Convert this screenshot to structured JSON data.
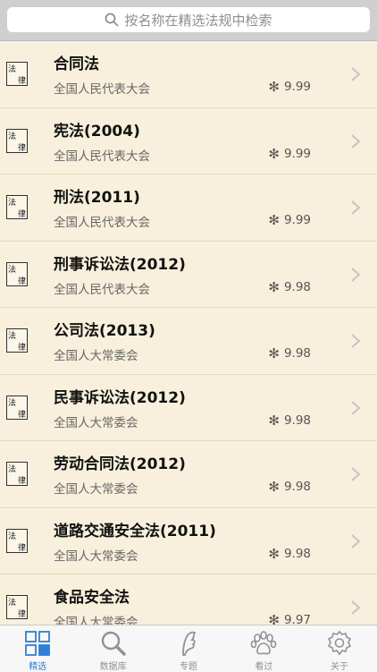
{
  "search": {
    "placeholder": "按名称在精选法规中检索"
  },
  "law_icon": {
    "char1": "法",
    "char2": "律"
  },
  "items": [
    {
      "title": "合同法",
      "issuer": "全国人民代表大会",
      "score": "9.99"
    },
    {
      "title": "宪法(2004)",
      "issuer": "全国人民代表大会",
      "score": "9.99"
    },
    {
      "title": "刑法(2011)",
      "issuer": "全国人民代表大会",
      "score": "9.99"
    },
    {
      "title": "刑事诉讼法(2012)",
      "issuer": "全国人民代表大会",
      "score": "9.98"
    },
    {
      "title": "公司法(2013)",
      "issuer": "全国人大常委会",
      "score": "9.98"
    },
    {
      "title": "民事诉讼法(2012)",
      "issuer": "全国人大常委会",
      "score": "9.98"
    },
    {
      "title": "劳动合同法(2012)",
      "issuer": "全国人大常委会",
      "score": "9.98"
    },
    {
      "title": "道路交通安全法(2011)",
      "issuer": "全国人大常委会",
      "score": "9.98"
    },
    {
      "title": "食品安全法",
      "issuer": "全国人大常委会",
      "score": "9.97"
    }
  ],
  "tabs": [
    {
      "label": "精选",
      "icon": "grid-icon",
      "active": true
    },
    {
      "label": "数据库",
      "icon": "magnifier-icon",
      "active": false
    },
    {
      "label": "专题",
      "icon": "leaf-icon",
      "active": false
    },
    {
      "label": "看过",
      "icon": "paw-icon",
      "active": false
    },
    {
      "label": "关于",
      "icon": "gear-icon",
      "active": false
    }
  ],
  "colors": {
    "accent": "#2f7fd6",
    "background": "#f8f0dc",
    "tab_inactive": "#929292"
  }
}
